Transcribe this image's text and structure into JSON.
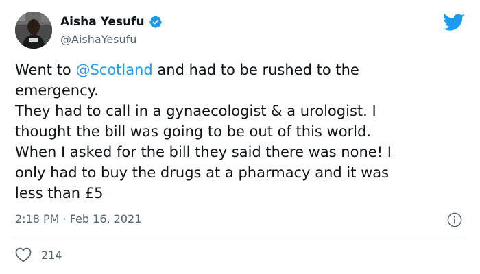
{
  "author": {
    "display_name": "Aisha Yesufu",
    "handle": "@AishaYesufu",
    "verified": true,
    "avatar_icon": "profile-photo"
  },
  "tweet": {
    "lines": [
      {
        "before": "Went to ",
        "mention": "@Scotland",
        "after": " and had to be rushed to the"
      },
      {
        "text": "emergency."
      },
      {
        "text": "They had to call in a gynaecologist & a urologist. I"
      },
      {
        "text": "thought the bill was going to be out of this world."
      },
      {
        "text": "When I asked for the bill they said there was none! I"
      },
      {
        "text": "only had to buy the drugs at a pharmacy and it was"
      },
      {
        "text": "less than £5"
      }
    ],
    "timestamp": "2:18 PM · Feb 16, 2021"
  },
  "engagement": {
    "likes": "214",
    "like_icon": "heart-icon",
    "info_icon": "info-icon"
  },
  "branding": {
    "logo_icon": "twitter-bird-icon",
    "accent_color": "#1d9bf0",
    "verified_color": "#1d9bf0",
    "text_color": "#0f1419",
    "secondary_color": "#536471"
  }
}
